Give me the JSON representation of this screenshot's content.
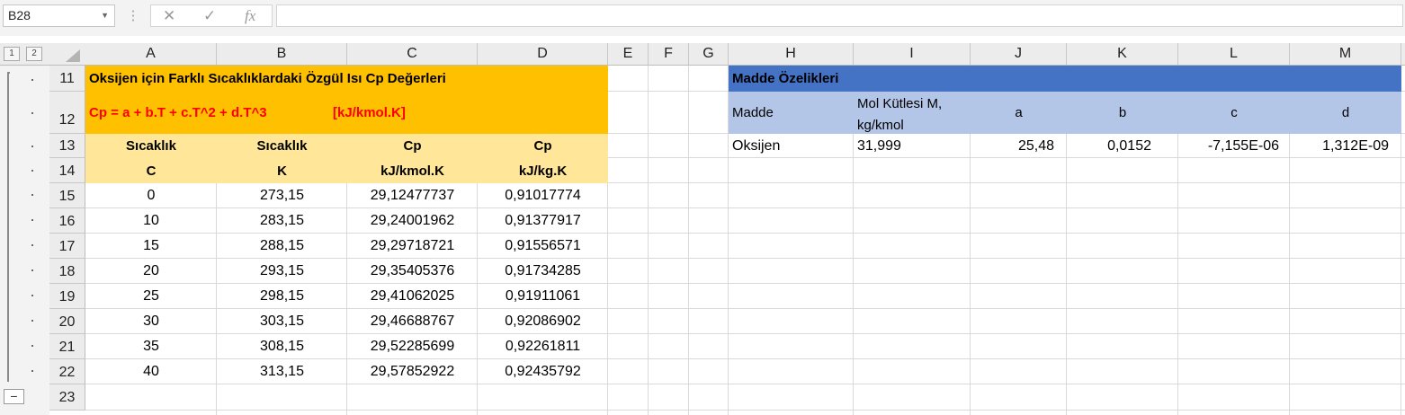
{
  "name_box": "B28",
  "formula_icons": {
    "cancel": "✕",
    "enter": "✓",
    "function": "fx"
  },
  "formula_value": "",
  "outline": {
    "levels": [
      "1",
      "2"
    ],
    "collapse": "−"
  },
  "columns": [
    "A",
    "B",
    "C",
    "D",
    "E",
    "F",
    "G",
    "H",
    "I",
    "J",
    "K",
    "L",
    "M"
  ],
  "rows": [
    "11",
    "12",
    "13",
    "14",
    "15",
    "16",
    "17",
    "18",
    "19",
    "20",
    "21",
    "22",
    "23"
  ],
  "colors": {
    "orange": "#ffc000",
    "light_orange": "#ffe699",
    "blue": "#4472c4",
    "light_blue": "#b4c6e7",
    "red_text": "#ff0000"
  },
  "cp_table": {
    "title": "Oksijen için Farklı Sıcaklıklardaki Özgül Isı Cp Değerleri",
    "formula": "Cp = a + b.T + c.T^2 + d.T^3",
    "units": "[kJ/kmol.K]",
    "headers_row1": [
      "Sıcaklık",
      "Sıcaklık",
      "Cp",
      "Cp"
    ],
    "headers_row2": [
      "C",
      "K",
      "kJ/kmol.K",
      "kJ/kg.K"
    ],
    "data": [
      [
        "0",
        "273,15",
        "29,12477737",
        "0,91017774"
      ],
      [
        "10",
        "283,15",
        "29,24001962",
        "0,91377917"
      ],
      [
        "15",
        "288,15",
        "29,29718721",
        "0,91556571"
      ],
      [
        "20",
        "293,15",
        "29,35405376",
        "0,91734285"
      ],
      [
        "25",
        "298,15",
        "29,41062025",
        "0,91911061"
      ],
      [
        "30",
        "303,15",
        "29,46688767",
        "0,92086902"
      ],
      [
        "35",
        "308,15",
        "29,52285699",
        "0,92261811"
      ],
      [
        "40",
        "313,15",
        "29,57852922",
        "0,92435792"
      ]
    ]
  },
  "properties": {
    "title": "Madde Özelikleri",
    "headers": [
      "Madde",
      "Mol Kütlesi M,",
      "kg/kmol",
      "a",
      "b",
      "c",
      "d"
    ],
    "row": [
      "Oksijen",
      "31,999",
      "25,48",
      "0,0152",
      "-7,155E-06",
      "1,312E-09"
    ]
  }
}
